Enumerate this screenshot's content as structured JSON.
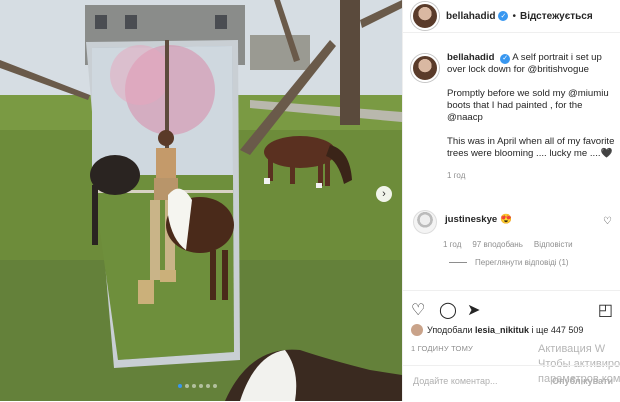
{
  "post": {
    "username": "bellahadid",
    "follow_status": "Відстежується",
    "caption_lines": [
      "A self portrait i set up over lock down for @britishvogue",
      "Promptly before we sold my @miumiu boots that I had painted , for the @naacp",
      "This was in April when all of my favorite trees were blooming .... lucky me ....🖤"
    ],
    "caption_time": "1 год",
    "likes_prefix": "Уподобали",
    "likes_user": "lesia_nikituk",
    "likes_suffix": "і ще 447 509",
    "post_date": "1 ГОДИНУ ТОМУ",
    "add_comment_placeholder": "Додайте коментар...",
    "publish_label": "Опублікувати"
  },
  "comment": {
    "username": "justineskye",
    "emoji": "😍",
    "time": "1 год",
    "likes": "97 вподобань",
    "reply": "Відповісти",
    "view_replies": "Переглянути відповіді (1)"
  },
  "watermark": [
    "Активация W",
    "Чтобы активиров",
    "параметров ком"
  ],
  "carousel": {
    "total": 6,
    "active": 0
  },
  "icons": [
    "heart-icon",
    "comment-icon",
    "share-icon",
    "bookmark-icon",
    "chevron-right-icon",
    "verified-badge-icon"
  ],
  "colors": {
    "accent": "#3897f0",
    "text": "#262626",
    "muted": "#8e8e8e"
  }
}
